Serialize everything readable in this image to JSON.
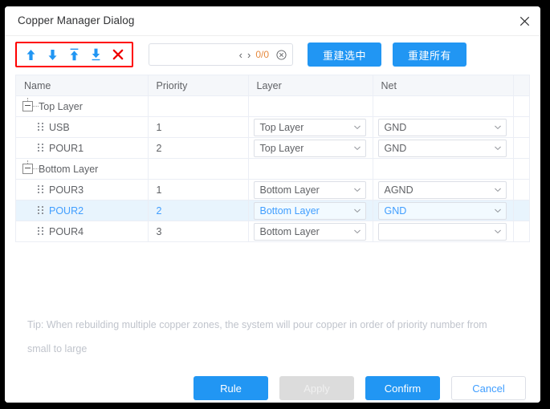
{
  "dialog": {
    "title": "Copper Manager Dialog",
    "close_icon": "close-icon"
  },
  "toolbar": {
    "icons": [
      {
        "name": "move-up-icon",
        "glyph": "arrow-up",
        "color": "#2196f3"
      },
      {
        "name": "move-down-icon",
        "glyph": "arrow-down",
        "color": "#2196f3"
      },
      {
        "name": "move-to-top-icon",
        "glyph": "arrow-up-bar",
        "color": "#2196f3"
      },
      {
        "name": "move-to-bottom-icon",
        "glyph": "arrow-down-bar",
        "color": "#2196f3"
      },
      {
        "name": "delete-icon",
        "glyph": "cross",
        "color": "#ff0000"
      }
    ],
    "highlight_color": "#ff0000",
    "search": {
      "value": "",
      "placeholder": "",
      "prev_label": "‹",
      "next_label": "›",
      "match_count": "0/0",
      "match_count_color": "#e6893d",
      "clear_icon": "clear-circle-icon"
    },
    "rebuild_selected_label": "重建选中",
    "rebuild_all_label": "重建所有",
    "accent_color": "#2196f3"
  },
  "table": {
    "columns": [
      "Name",
      "Priority",
      "Layer",
      "Net"
    ],
    "rows": [
      {
        "type": "group",
        "name": "Top Layer",
        "priority": "",
        "layer": null,
        "net": null,
        "selected": false
      },
      {
        "type": "item",
        "name": "USB",
        "priority": "1",
        "layer": "Top Layer",
        "net": "GND",
        "selected": false
      },
      {
        "type": "item",
        "name": "POUR1",
        "priority": "2",
        "layer": "Top Layer",
        "net": "GND",
        "selected": false
      },
      {
        "type": "group",
        "name": "Bottom Layer",
        "priority": "",
        "layer": null,
        "net": null,
        "selected": false
      },
      {
        "type": "item",
        "name": "POUR3",
        "priority": "1",
        "layer": "Bottom Layer",
        "net": "AGND",
        "selected": false
      },
      {
        "type": "item",
        "name": "POUR2",
        "priority": "2",
        "layer": "Bottom Layer",
        "net": "GND",
        "selected": true
      },
      {
        "type": "item",
        "name": "POUR4",
        "priority": "3",
        "layer": "Bottom Layer",
        "net": "",
        "selected": false
      }
    ],
    "selected_row_bg": "#e8f4fd",
    "selected_row_color": "#409eff"
  },
  "tip": {
    "text": "Tip: When rebuilding multiple copper zones, the system will pour copper in order of priority number from small to large"
  },
  "footer": {
    "rule_label": "Rule",
    "apply_label": "Apply",
    "confirm_label": "Confirm",
    "cancel_label": "Cancel"
  }
}
